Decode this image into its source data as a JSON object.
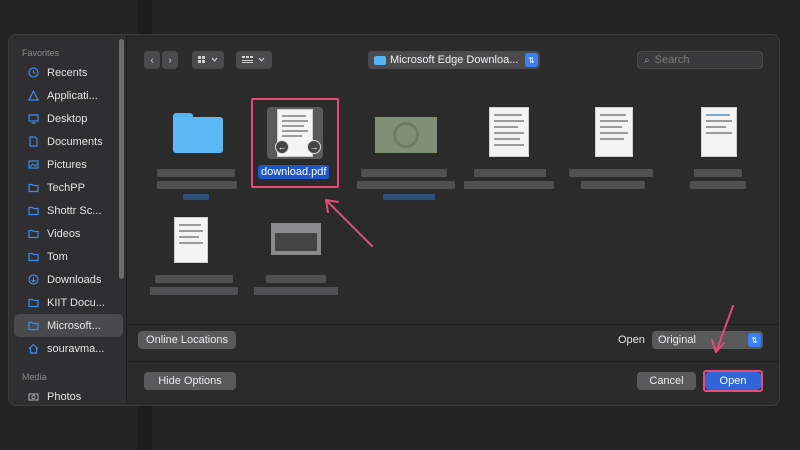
{
  "sidebar": {
    "favorites_label": "Favorites",
    "media_label": "Media",
    "items": [
      {
        "label": "Recents",
        "icon": "clock-icon"
      },
      {
        "label": "Applicati...",
        "icon": "applications-icon"
      },
      {
        "label": "Desktop",
        "icon": "desktop-icon"
      },
      {
        "label": "Documents",
        "icon": "document-icon"
      },
      {
        "label": "Pictures",
        "icon": "pictures-icon"
      },
      {
        "label": "TechPP",
        "icon": "folder-icon"
      },
      {
        "label": "Shottr Sc...",
        "icon": "folder-icon"
      },
      {
        "label": "Videos",
        "icon": "folder-icon"
      },
      {
        "label": "Tom",
        "icon": "folder-icon"
      },
      {
        "label": "Downloads",
        "icon": "download-icon"
      },
      {
        "label": "KIIT Docu...",
        "icon": "folder-icon"
      },
      {
        "label": "Microsoft...",
        "icon": "folder-icon"
      },
      {
        "label": "souravma...",
        "icon": "home-icon"
      }
    ],
    "media_items": [
      {
        "label": "Photos",
        "icon": "camera-icon"
      }
    ]
  },
  "toolbar": {
    "back_glyph": "‹",
    "forward_glyph": "›",
    "location": "Microsoft Edge Downloa...",
    "search_placeholder": "Search"
  },
  "files": {
    "selected_name": "download.pdf"
  },
  "footer": {
    "online_locations": "Online Locations",
    "open_label": "Open",
    "format_value": "Original",
    "hide_options": "Hide Options",
    "cancel": "Cancel",
    "open_button": "Open"
  },
  "colors": {
    "accent": "#2f65d6",
    "highlight": "#e64a76",
    "folder": "#5cb9f6"
  }
}
